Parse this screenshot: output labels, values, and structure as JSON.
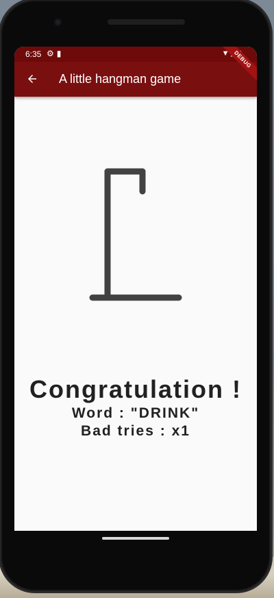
{
  "status_bar": {
    "time": "6:35",
    "left_icons": [
      "settings-gear-icon",
      "sd-card-icon"
    ],
    "right_icons": [
      "wifi-icon",
      "signal-icon",
      "battery-icon"
    ]
  },
  "app_bar": {
    "title": "A little hangman game",
    "back_icon": "arrow-left-icon",
    "color": "#7a0f0f",
    "status_color": "#6e0a0a"
  },
  "debug_banner": "DEBUG",
  "result": {
    "title": "Congratulation !",
    "word_line": "Word : \"DRINK\"",
    "tries_line": "Bad tries : x1"
  },
  "hangman": {
    "stage": 1,
    "stroke_color": "#424242"
  }
}
